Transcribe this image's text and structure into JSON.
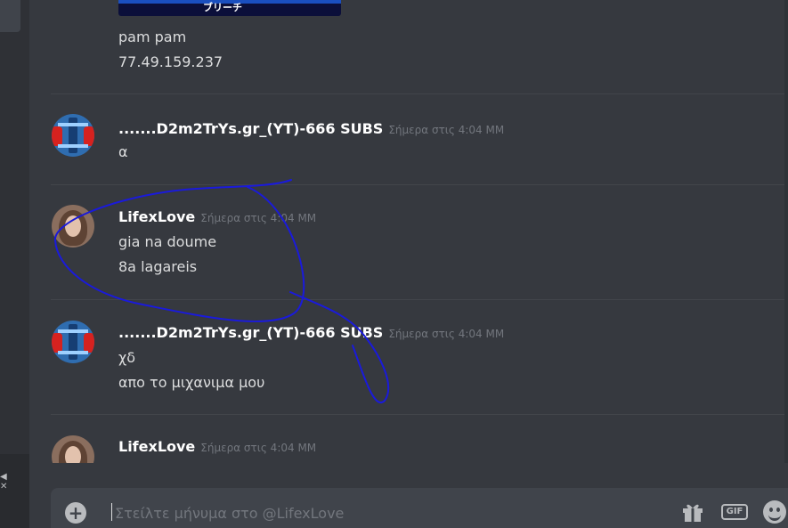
{
  "chat": {
    "messages": [
      {
        "lines": [
          "pam pam",
          "77.49.159.237"
        ],
        "embed_text": "ブリーチ"
      },
      {
        "author": ".......D2m2TrYs.gr_(YT)-666 SUBS",
        "timestamp": "Σήμερα στις 4:04 ΜΜ",
        "lines": [
          "α"
        ]
      },
      {
        "author": "LifexLove",
        "timestamp": "Σήμερα στις 4:04 ΜΜ",
        "lines": [
          "gia na doume",
          "8a lagareis"
        ]
      },
      {
        "author": ".......D2m2TrYs.gr_(YT)-666 SUBS",
        "timestamp": "Σήμερα στις 4:04 ΜΜ",
        "lines": [
          "χδ",
          "απο το μιχανιμα μου"
        ]
      },
      {
        "author": "LifexLove",
        "timestamp": "Σήμερα στις 4:04 ΜΜ",
        "lines": []
      }
    ]
  },
  "composer": {
    "placeholder": "Στείλτε μήνυμα στο @LifexLove",
    "gif_label": "GIF"
  },
  "icons": {
    "plus": "plus-circle-icon",
    "gift": "gift-icon",
    "gif": "gif-icon",
    "emoji": "emoji-icon"
  },
  "colors": {
    "background": "#36393f",
    "composer": "#40444b",
    "username": "#ffffff",
    "timestamp": "#72767d",
    "annotation": "#1a1adb"
  }
}
